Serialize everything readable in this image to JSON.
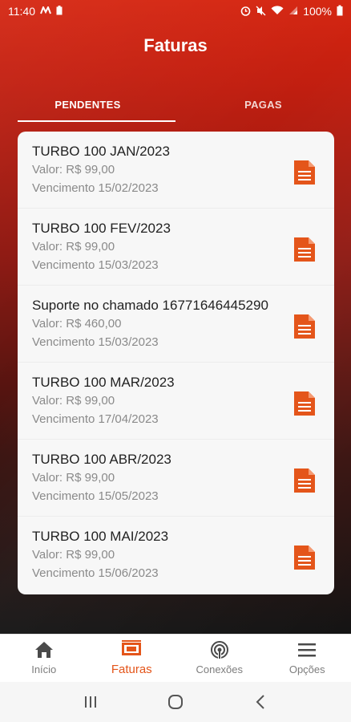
{
  "status_bar": {
    "time": "11:40",
    "battery": "100%",
    "left_icons": [
      "m-logo-icon",
      "battery-saver-icon"
    ],
    "right_icons": [
      "alarm-icon",
      "mute-icon",
      "wifi-icon",
      "signal-icon",
      "battery-icon"
    ]
  },
  "header": {
    "title": "Faturas"
  },
  "tabs": [
    {
      "label": "PENDENTES",
      "active": true
    },
    {
      "label": "PAGAS",
      "active": false
    }
  ],
  "invoices": [
    {
      "title": "TURBO 100 JAN/2023",
      "value": "Valor: R$ 99,00",
      "due": "Vencimento 15/02/2023"
    },
    {
      "title": "TURBO 100 FEV/2023",
      "value": "Valor: R$ 99,00",
      "due": "Vencimento 15/03/2023"
    },
    {
      "title": "Suporte no chamado 16771646445290",
      "value": "Valor: R$ 460,00",
      "due": "Vencimento 15/03/2023"
    },
    {
      "title": "TURBO 100 MAR/2023",
      "value": "Valor: R$ 99,00",
      "due": "Vencimento 17/04/2023"
    },
    {
      "title": "TURBO 100 ABR/2023",
      "value": "Valor: R$ 99,00",
      "due": "Vencimento 15/05/2023"
    },
    {
      "title": "TURBO 100 MAI/2023",
      "value": "Valor: R$ 99,00",
      "due": "Vencimento 15/06/2023"
    }
  ],
  "bottom_nav": [
    {
      "label": "Início",
      "icon": "home-icon",
      "active": false
    },
    {
      "label": "Faturas",
      "icon": "invoice-icon",
      "active": true
    },
    {
      "label": "Conexões",
      "icon": "connection-icon",
      "active": false
    },
    {
      "label": "Opções",
      "icon": "menu-icon",
      "active": false
    }
  ],
  "colors": {
    "accent": "#e4551a",
    "header_red": "#d52611",
    "card_bg": "#f7f7f7"
  }
}
